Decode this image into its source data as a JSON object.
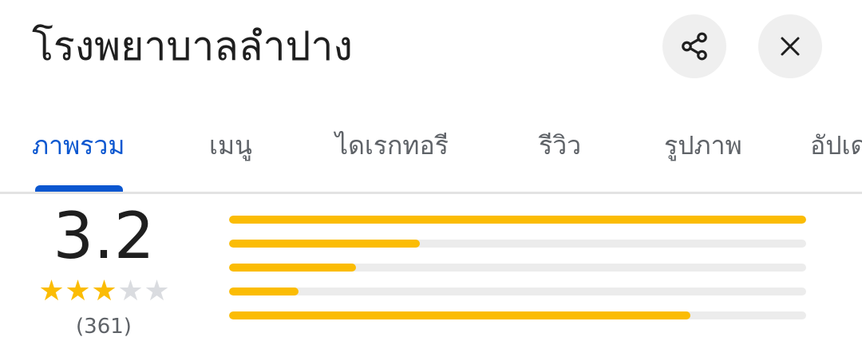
{
  "header": {
    "title": "โรงพยาบาลลำปาง",
    "share_icon": "share-icon",
    "close_icon": "close-icon"
  },
  "tabs": [
    {
      "label": "ภาพรวม",
      "active": true
    },
    {
      "label": "เมนู",
      "active": false
    },
    {
      "label": "ไดเรกทอรี",
      "active": false
    },
    {
      "label": "รีวิว",
      "active": false
    },
    {
      "label": "รูปภาพ",
      "active": false
    },
    {
      "label": "อัปเด",
      "active": false
    }
  ],
  "rating": {
    "value": "3.2",
    "stars_filled": 3,
    "stars_total": 5,
    "review_count": "(361)"
  },
  "distribution": [
    {
      "stars": 5,
      "fraction": 1.0
    },
    {
      "stars": 4,
      "fraction": 0.33
    },
    {
      "stars": 3,
      "fraction": 0.22
    },
    {
      "stars": 2,
      "fraction": 0.12
    },
    {
      "stars": 1,
      "fraction": 0.8
    }
  ],
  "colors": {
    "accent": "#0b57d0",
    "star": "#fbbc04",
    "track": "#ececec"
  }
}
